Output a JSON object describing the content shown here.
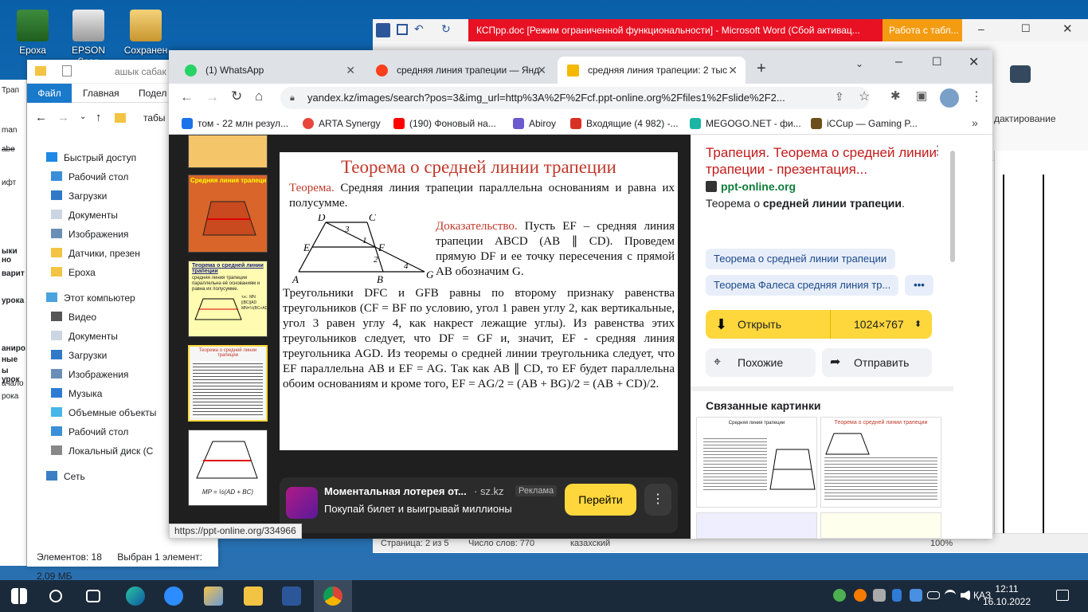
{
  "desktop": {
    "icons": [
      {
        "label": "Ероха"
      },
      {
        "label": "EPSON Scan"
      },
      {
        "label": "Сохранен"
      }
    ]
  },
  "word": {
    "title": "КСПрр.doc [Режим ограниченной функциональности]  -  Microsoft Word (Сбой активац...",
    "context_tab": "Работа с табл...",
    "ribbon_right": "дактирование",
    "status_page": "Страница: 2 из 5",
    "status_words": "Число слов: 770",
    "status_lang": "казахский",
    "zoom": "100%"
  },
  "explorer": {
    "search_hint": "ашык сабак",
    "tab_file": "Файл",
    "tab_home": "Главная",
    "tab_share": "Подел",
    "path": "табы",
    "items": [
      {
        "label": "Быстрый доступ"
      },
      {
        "label": "Рабочий стол"
      },
      {
        "label": "Загрузки"
      },
      {
        "label": "Документы"
      },
      {
        "label": "Изображения"
      },
      {
        "label": "Датчики, презен"
      },
      {
        "label": "Ероха"
      },
      {
        "label": "Этот компьютер"
      },
      {
        "label": "Видео"
      },
      {
        "label": "Документы"
      },
      {
        "label": "Загрузки"
      },
      {
        "label": "Изображения"
      },
      {
        "label": "Музыка"
      },
      {
        "label": "Объемные объекты"
      },
      {
        "label": "Рабочий стол"
      },
      {
        "label": "Локальный диск (С"
      },
      {
        "label": "Сеть"
      }
    ],
    "status_count": "Элементов: 18",
    "status_selected": "Выбран 1 элемент: 2,09 МБ"
  },
  "doc_left": {
    "lines": [
      "Трап",
      "man",
      "abe",
      "ифт",
      "ыки но",
      "варит",
      "урока",
      "аниро",
      "ные",
      "ы урок",
      "ачало",
      "рока"
    ]
  },
  "chrome": {
    "tabs": [
      {
        "label": "(1) WhatsApp"
      },
      {
        "label": "средняя линия трапеции — Янд"
      },
      {
        "label": "средняя линия трапеции: 2 тыс"
      }
    ],
    "url": "yandex.kz/images/search?pos=3&img_url=http%3A%2F%2Fcf.ppt-online.org%2Ffiles1%2Fslide%2F2...",
    "bookmarks": [
      {
        "label": "том - 22 млн резул..."
      },
      {
        "label": "ARTA Synergy"
      },
      {
        "label": "(190) Фоновый на..."
      },
      {
        "label": "Abiroy"
      },
      {
        "label": "Входящие (4 982) -..."
      },
      {
        "label": "MEGOGO.NET - фи..."
      },
      {
        "label": "iCCup — Gaming P..."
      }
    ],
    "status_url": "https://ppt-online.org/334966"
  },
  "slide": {
    "title": "Теорема о средней линии трапеции",
    "theorem_label": "Теорема.",
    "theorem_text": "Средняя линия трапеции параллельна основаниям и равна их полусумме.",
    "proof_label": "Доказательство.",
    "proof_text1": "Пусть EF – средняя линия трапеции ABCD (AB ∥ CD). Проведем прямую DF и ее точку пересечения с прямой AB обозначим G.",
    "proof_text2": "Треугольники DFC и GFB равны по второму признаку равенства треугольников (CF = BF  по условию, угол 1 равен углу 2, как вертикальные, угол 3 равен углу 4, как накрест лежащие углы). Из равенства этих треугольников следует, что DF = GF и, значит, EF - средняя линия треугольника AGD. Из теоремы о средней линии треугольника следует, что EF параллельна AB и EF = AG. Так как AB ∥ CD, то EF будет параллельна обоим основаниям и кроме того, EF = AG/2 =  (AB + BG)/2 = (AB + CD)/2.",
    "fig": {
      "A": "A",
      "B": "B",
      "C": "C",
      "D": "D",
      "E": "E",
      "F": "F",
      "G": "G",
      "n1": "1",
      "n2": "2",
      "n3": "3",
      "n4": "4"
    }
  },
  "thumbs": {
    "t2_title": "Средняя линия трапеции",
    "t3_title": "Теорема о средней линии трапеции",
    "t3_body": "средняя линия трапеции параллельна её основаниям и равна их полусумме.",
    "t3_note": "т.е.: MN ||BC||AD MN=½(BC+AD)",
    "t4_title": "Теорема о средней линии трапеции",
    "t5_formula": "MP = ½(AD + BC)"
  },
  "side": {
    "title": "Трапеция. Теорема о средней линии трапеции - презентация...",
    "site": "ppt-online.org",
    "desc_plain": "Теорема о ",
    "desc_bold": "средней линии трапеции",
    "desc_end": ".",
    "chips": [
      {
        "label": "Теорема о средней линии трапеции"
      },
      {
        "label": "Теорема Фалеса средняя линия тр..."
      }
    ],
    "more": "•••",
    "open": "Открыть",
    "size": "1024×767",
    "similar": "Похожие",
    "send": "Отправить",
    "related": "Связанные картинки",
    "rel1_title": "Средняя линия трапеции",
    "rel2_title": "Теорема о средней линии трапеции"
  },
  "ad": {
    "title": "Моментальная лотерея от...",
    "source": "· sz.kz",
    "badge": "Реклама",
    "subtitle": "Покупай билет и выигрывай миллионы",
    "button": "Перейти"
  },
  "taskbar": {
    "lang": "ҚАЗ",
    "time": "12:11",
    "date": "16.10.2022"
  },
  "colors": {
    "accent_yellow": "#fed73c",
    "slide_title": "#c0392b",
    "word_red": "#e81123"
  }
}
